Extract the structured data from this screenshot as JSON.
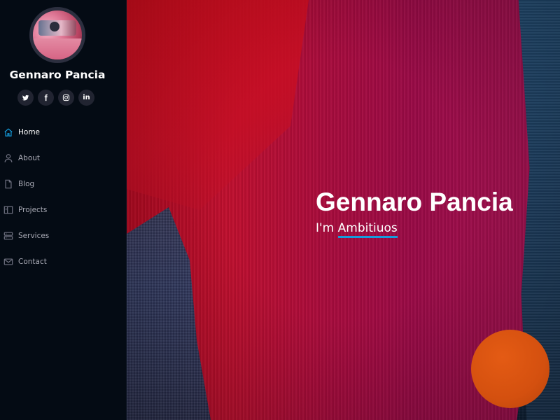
{
  "profile": {
    "name": "Gennaro Pancia"
  },
  "social": [
    {
      "icon": "twitter-icon"
    },
    {
      "icon": "facebook-icon"
    },
    {
      "icon": "instagram-icon"
    },
    {
      "icon": "linkedin-icon",
      "glyph": "in"
    }
  ],
  "nav": {
    "items": [
      {
        "label": "Home",
        "icon": "home-icon",
        "active": true
      },
      {
        "label": "About",
        "icon": "person-icon"
      },
      {
        "label": "Blog",
        "icon": "file-icon"
      },
      {
        "label": "Projects",
        "icon": "book-icon"
      },
      {
        "label": "Services",
        "icon": "server-icon"
      },
      {
        "label": "Contact",
        "icon": "envelope-icon"
      }
    ]
  },
  "hero": {
    "title": "Gennaro Pancia",
    "sub_prefix": "I'm",
    "typed": "Ambitiuos"
  },
  "colors": {
    "accent": "#149ddd",
    "sidebar_bg": "#040b14",
    "orange": "#d4500f"
  }
}
